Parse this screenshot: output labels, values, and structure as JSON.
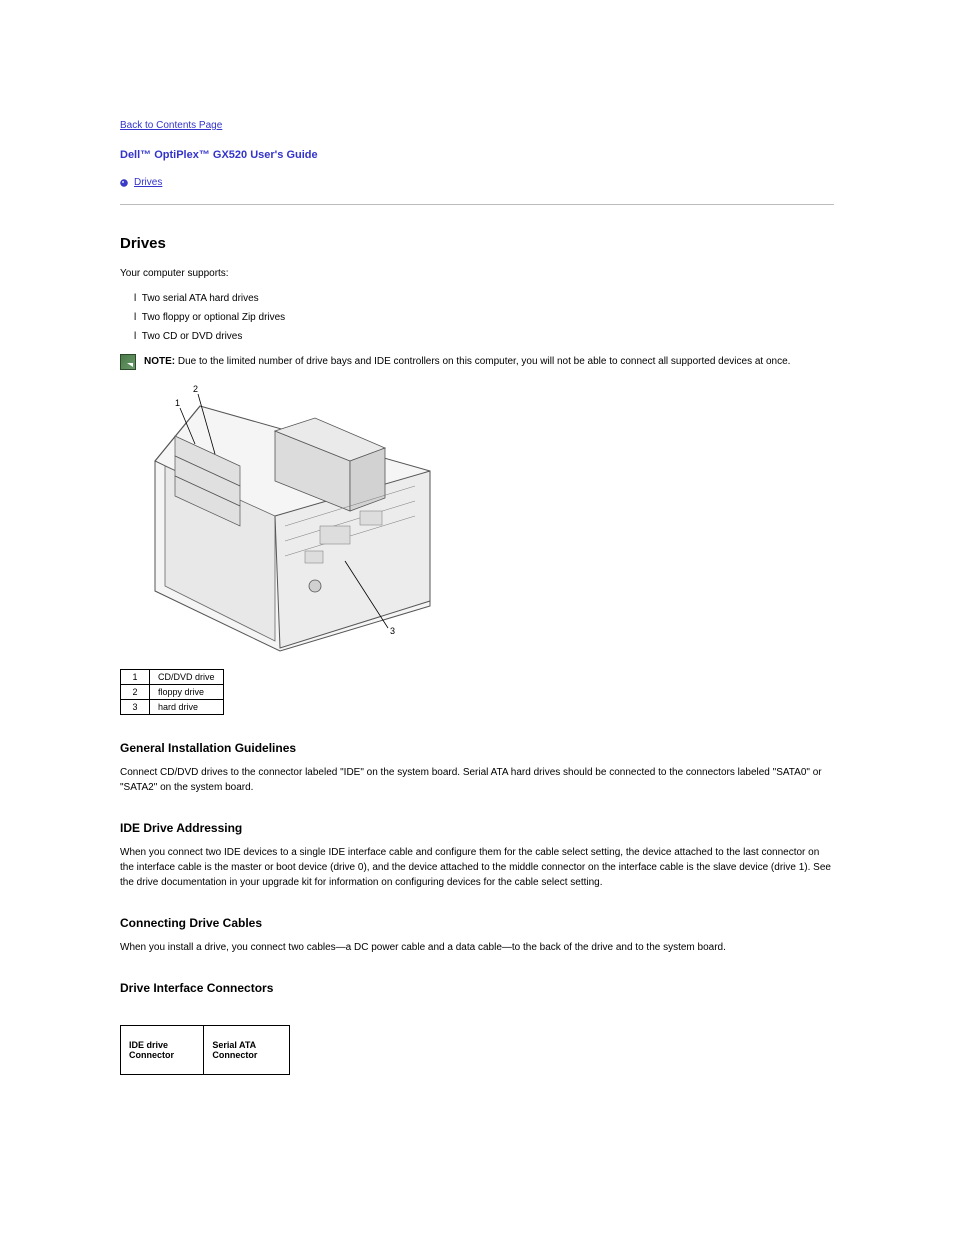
{
  "back_link": "Back to Contents Page",
  "guide_title": "Dell™ OptiPlex™ GX520 User's Guide",
  "top_bullet": "Drives",
  "sections": {
    "drives_heading": "Drives",
    "drives_intro": "Your computer supports:",
    "drives_list": [
      "Two serial ATA hard drives",
      "Two floppy or optional Zip drives",
      "Two CD or DVD drives"
    ],
    "note_prefix": "NOTE:",
    "note_text": " Due to the limited number of drive bays and IDE controllers on this computer, you will not be able to connect all supported devices at once.",
    "callouts": [
      {
        "n": "1",
        "label": "CD/DVD drive"
      },
      {
        "n": "2",
        "label": "floppy drive"
      },
      {
        "n": "3",
        "label": "hard drive"
      }
    ],
    "guidelines_heading": "General Installation Guidelines",
    "guidelines_p1": "Connect CD/DVD drives to the connector labeled \"IDE\" on the system board. Serial ATA hard drives should be connected to the connectors labeled \"SATA0\" or \"SATA2\" on the system board.",
    "ide_heading": "IDE Drive Addressing",
    "ide_p1": "When you connect two IDE devices to a single IDE interface cable and configure them for the cable select setting, the device attached to the last connector on the interface cable is the master or boot device (drive 0), and the device attached to the middle connector on the interface cable is the slave device (drive 1). See the drive documentation in your upgrade kit for information on configuring devices for the cable select setting.",
    "cables_heading": "Connecting Drive Cables",
    "cables_p1": "When you install a drive, you connect two cables—a DC power cable and a data cable—to the back of the drive and to the system board.",
    "interface_heading": "Drive Interface Connectors",
    "spec_table": {
      "left": "IDE drive Connector",
      "right": "Serial ATA Connector"
    }
  }
}
